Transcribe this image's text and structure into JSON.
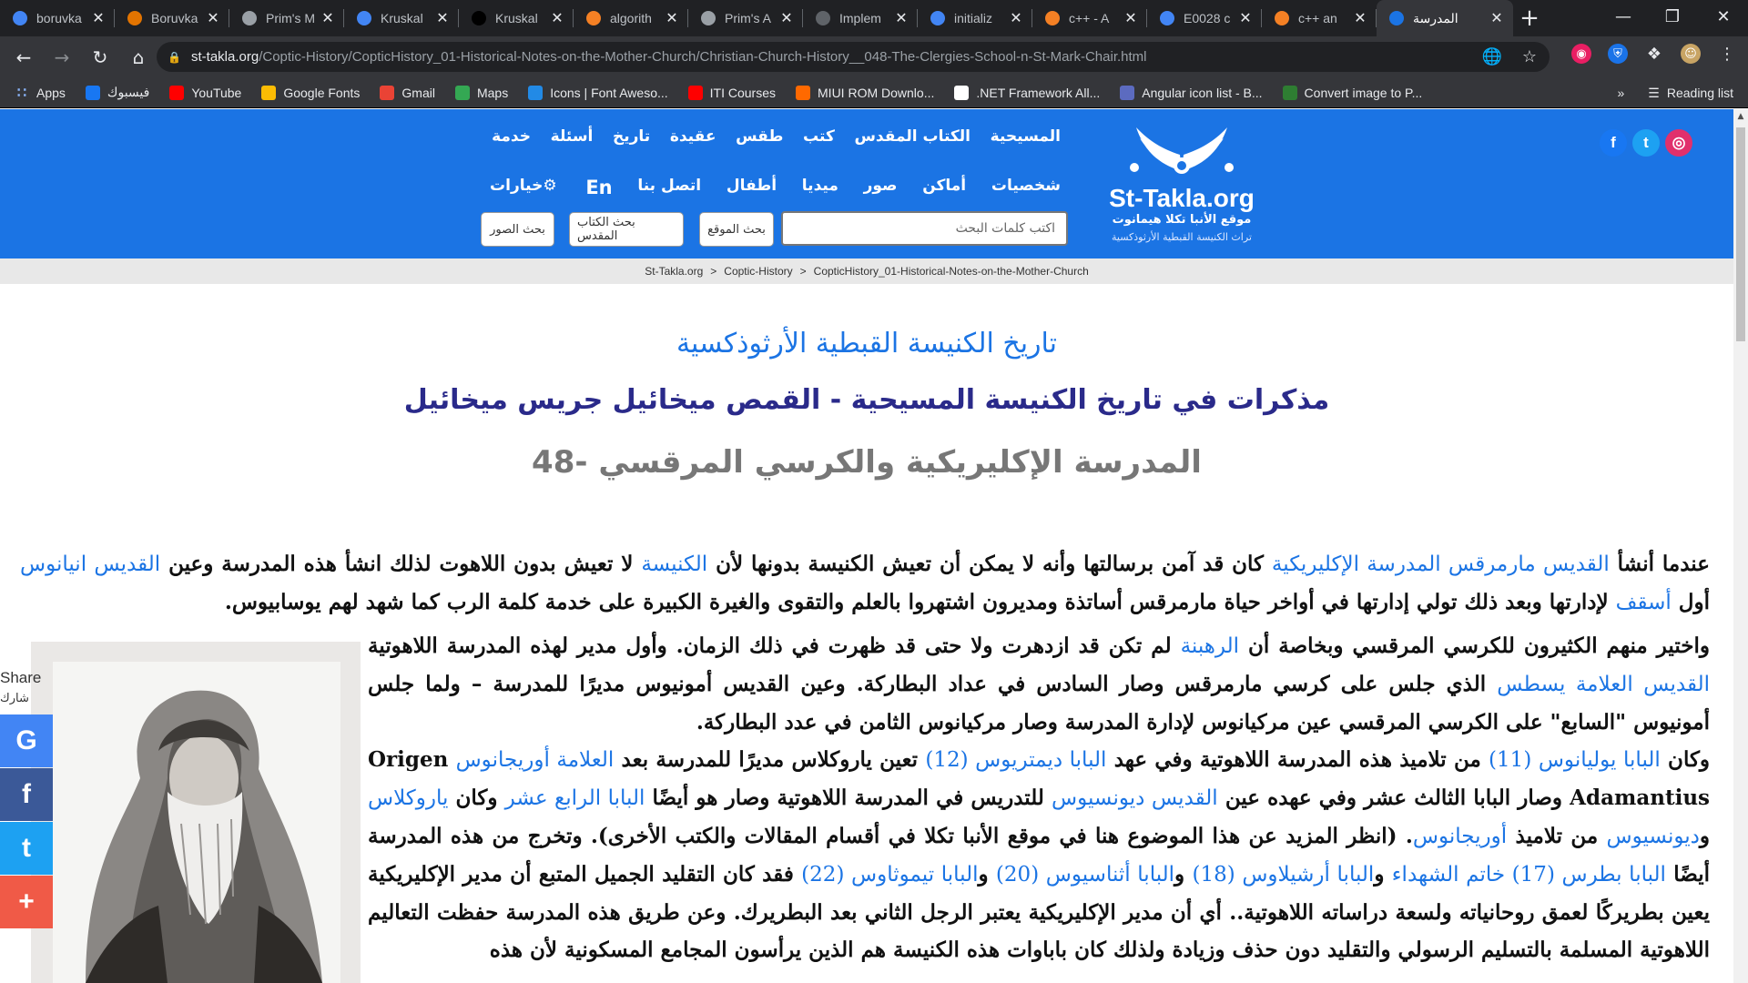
{
  "browser": {
    "tabs": [
      {
        "title": "boruvka",
        "icon": "google-icon",
        "color": "#4285f4"
      },
      {
        "title": "Boruvka",
        "icon": "sourcegraph-icon",
        "color": "#e37400"
      },
      {
        "title": "Prim's M",
        "icon": "geeks-icon",
        "color": "#9aa0a6"
      },
      {
        "title": "Kruskal",
        "icon": "google-icon",
        "color": "#4285f4"
      },
      {
        "title": "Kruskal",
        "icon": "th-icon",
        "color": "#000000"
      },
      {
        "title": "algorith",
        "icon": "stackoverflow-icon",
        "color": "#f48024"
      },
      {
        "title": "Prim's A",
        "icon": "geeks-icon",
        "color": "#9aa0a6"
      },
      {
        "title": "Implem",
        "icon": "globe-icon",
        "color": "#5f6368"
      },
      {
        "title": "initializ",
        "icon": "google-icon",
        "color": "#4285f4"
      },
      {
        "title": "c++ - A",
        "icon": "stackoverflow-icon",
        "color": "#f48024"
      },
      {
        "title": "E0028 c",
        "icon": "google-icon",
        "color": "#4285f4"
      },
      {
        "title": "c++ an",
        "icon": "stackoverflow-icon",
        "color": "#f48024"
      },
      {
        "title": "المدرسة",
        "icon": "sttakla-icon",
        "color": "#1b74e4"
      }
    ],
    "url_host": "st-takla.org",
    "url_path": "/Coptic-History/CopticHistory_01-Historical-Notes-on-the-Mother-Church/Christian-Church-History__048-The-Clergies-School-n-St-Mark-Chair.html",
    "bookmarks": [
      {
        "label": "Apps",
        "icon": "apps-grid-icon",
        "color": "#e8eaed"
      },
      {
        "label": "فيسبوك",
        "icon": "facebook-icon",
        "color": "#1877f2"
      },
      {
        "label": "YouTube",
        "icon": "youtube-icon",
        "color": "#ff0000"
      },
      {
        "label": "Google Fonts",
        "icon": "google-fonts-icon",
        "color": "#fbbc04"
      },
      {
        "label": "Gmail",
        "icon": "gmail-icon",
        "color": "#ea4335"
      },
      {
        "label": "Maps",
        "icon": "maps-icon",
        "color": "#34a853"
      },
      {
        "label": "Icons | Font Aweso...",
        "icon": "fontawesome-icon",
        "color": "#228ae6"
      },
      {
        "label": "ITI Courses",
        "icon": "youtube-icon",
        "color": "#ff0000"
      },
      {
        "label": "MIUI ROM Downlo...",
        "icon": "miui-icon",
        "color": "#ff6900"
      },
      {
        "label": ".NET Framework All...",
        "icon": "github-icon",
        "color": "#ffffff"
      },
      {
        "label": "Angular icon list - B...",
        "icon": "mdi-icon",
        "color": "#5c6bc0"
      },
      {
        "label": "Convert image to P...",
        "icon": "convert-icon",
        "color": "#2e7d32"
      }
    ],
    "overflow": "»",
    "reading_list": "Reading list"
  },
  "site": {
    "logo_name": "St-Takla.org",
    "logo_sub": "موقع الأنبا تكلا هيمانوت",
    "logo_sub2": "تراث الكنيسة القبطية الأرثوذكسية",
    "menu_row1": [
      "المسيحية",
      "الكتاب المقدس",
      "كتب",
      "طقس",
      "عقيدة",
      "تاريخ",
      "أسئلة",
      "خدمة"
    ],
    "menu_row2": [
      "شخصيات",
      "أماكن",
      "صور",
      "ميديا",
      "أطفال",
      "اتصل بنا",
      "En",
      "خيارات"
    ],
    "search_placeholder": "اكتب كلمات البحث",
    "search_buttons": [
      "بحث الموقع",
      "بحث الكتاب المقدس",
      "بحث الصور"
    ],
    "social": [
      {
        "name": "instagram-icon",
        "color": "#e1306c"
      },
      {
        "name": "twitter-icon",
        "color": "#1da1f2"
      },
      {
        "name": "facebook-icon",
        "color": "#1877f2"
      }
    ],
    "header_color": "#1b74e4"
  },
  "breadcrumb": [
    "St-Takla.org",
    "Coptic-History",
    "CopticHistory_01-Historical-Notes-on-the-Mother-Church"
  ],
  "breadcrumb_sep": ">",
  "article": {
    "title1": "تاريخ الكنيسة القبطية الأرثوذكسية",
    "title2": "مذكرات في تاريخ الكنيسة المسيحية - القمص ميخائيل جريس ميخائيل",
    "title3": "48- المدرسة الإكليريكية والكرسي المرقسي",
    "p1": [
      {
        "t": "عندما أنشأ "
      },
      {
        "t": "القديس مارمرقس المدرسة الإكليريكية",
        "link": true
      },
      {
        "t": " كان قد آمن برسالتها وأنه لا يمكن أن تعيش الكنيسة بدونها لأن "
      },
      {
        "t": "الكنيسة",
        "link": true
      },
      {
        "t": " لا تعيش بدون اللاهوت لذلك انشأ هذه المدرسة وعين "
      },
      {
        "t": "القديس انيانوس",
        "link": true
      },
      {
        "t": " أول "
      },
      {
        "t": "أسقف",
        "link": true
      },
      {
        "t": " لإدارتها وبعد ذلك تولي إدارتها في أواخر حياة مارمرقس أساتذة ومديرون اشتهروا بالعلم والتقوى والغيرة الكبيرة على خدمة كلمة الرب كما شهد لهم يوسابيوس."
      }
    ],
    "p2": [
      {
        "t": "واختير منهم الكثيرون للكرسي المرقسي وبخاصة أن "
      },
      {
        "t": "الرهبنة",
        "link": true
      },
      {
        "t": " لم تكن قد ازدهرت ولا حتى قد ظهرت في ذلك الزمان. وأول مدير لهذه المدرسة اللاهوتية "
      },
      {
        "t": "القديس العلامة يسطس",
        "link": true
      },
      {
        "t": " الذي جلس على كرسي مارمرقس وصار السادس في عداد البطاركة. وعين القديس أمونيوس مديرًا للمدرسة – ولما جلس أمونيوس \"السابع\" على الكرسي المرقسي عين مركيانوس لإدارة المدرسة وصار مركيانوس الثامن في عدد البطاركة."
      }
    ],
    "p3": [
      {
        "t": "وكان "
      },
      {
        "t": "البابا يوليانوس (11)",
        "link": true
      },
      {
        "t": " من تلاميذ هذه المدرسة اللاهوتية وفي عهد "
      },
      {
        "t": "البابا ديمتريوس (12)",
        "link": true
      },
      {
        "t": " تعين ياروكلاس مديرًا للمدرسة بعد "
      },
      {
        "t": "العلامة أوريجانوس",
        "link": true
      },
      {
        "t": " Origen Adamantius وصار البابا الثالث عشر وفي عهده عين "
      },
      {
        "t": "القديس ديونسيوس",
        "link": true
      },
      {
        "t": " للتدريس في المدرسة اللاهوتية وصار هو أيضًا "
      },
      {
        "t": "البابا الرابع عشر",
        "link": true
      },
      {
        "t": " وكان "
      },
      {
        "t": "ياروكلاس",
        "link": true
      },
      {
        "t": " و"
      },
      {
        "t": "ديونسيوس",
        "link": true
      },
      {
        "t": " من تلاميذ "
      },
      {
        "t": "أوريجانوس",
        "link": true
      },
      {
        "t": ". (انظر المزيد عن هذا الموضوع هنا في موقع الأنبا تكلا في أقسام المقالات والكتب الأخرى). وتخرج من هذه المدرسة أيضًا "
      },
      {
        "t": "البابا بطرس (17) خاتم الشهداء",
        "link": true
      },
      {
        "t": " و"
      },
      {
        "t": "البابا أرشيلاوس (18)",
        "link": true
      },
      {
        "t": " و"
      },
      {
        "t": "البابا أثناسيوس (20)",
        "link": true
      },
      {
        "t": " و"
      },
      {
        "t": "البابا تيموثاوس (22)",
        "link": true
      },
      {
        "t": " فقد كان التقليد الجميل المتبع أن مدير الإكليريكية يعين بطريركًا لعمق روحانياته ولسعة دراساته اللاهوتية.. أي أن مدير الإكليريكية يعتبر الرجل الثاني بعد البطريرك. وعن طريق هذه المدرسة حفظت التعاليم اللاهوتية المسلمة بالتسليم الرسولي والتقليد دون حذف وزيادة ولذلك كان باباوات هذه الكنيسة هم الذين يرأسون المجامع المسكونية لأن هذه"
      }
    ]
  },
  "share": {
    "label": "Share",
    "label_ar": "شارك",
    "buttons": [
      {
        "name": "share-google-icon",
        "glyph": "G",
        "color": "#4285f4"
      },
      {
        "name": "share-facebook-icon",
        "glyph": "f",
        "color": "#3b5998"
      },
      {
        "name": "share-twitter-icon",
        "glyph": "t",
        "color": "#1da1f2"
      },
      {
        "name": "share-more-icon",
        "glyph": "+",
        "color": "#f05a47"
      }
    ]
  }
}
